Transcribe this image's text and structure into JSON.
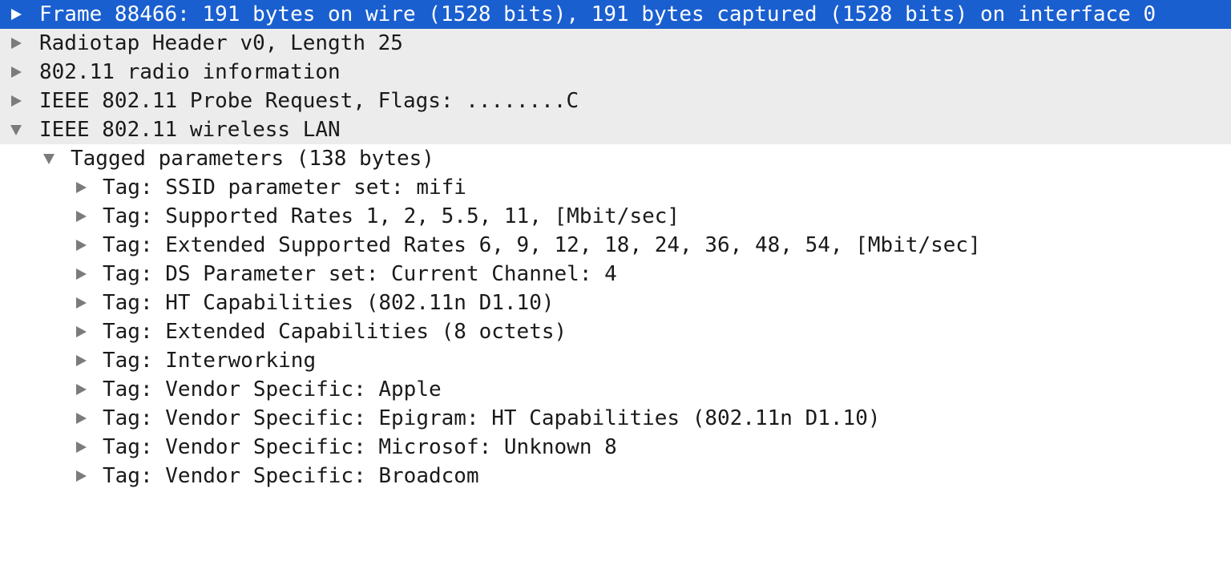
{
  "colors": {
    "selected_bg": "#1a5fd0",
    "top_level_bg": "#ececec",
    "arrow": "#7b7b7b",
    "text": "#1a1a1a"
  },
  "tree": [
    {
      "label": "Frame 88466: 191 bytes on wire (1528 bits), 191 bytes captured (1528 bits) on interface 0",
      "expanded": false,
      "selected": true,
      "icon": "disclosure-right-icon"
    },
    {
      "label": "Radiotap Header v0, Length 25",
      "expanded": false,
      "icon": "disclosure-right-icon"
    },
    {
      "label": "802.11 radio information",
      "expanded": false,
      "icon": "disclosure-right-icon"
    },
    {
      "label": "IEEE 802.11 Probe Request, Flags: ........C",
      "expanded": false,
      "icon": "disclosure-right-icon"
    },
    {
      "label": "IEEE 802.11 wireless LAN",
      "expanded": true,
      "icon": "disclosure-down-icon"
    },
    {
      "label": "Tagged parameters (138 bytes)",
      "expanded": true,
      "icon": "disclosure-down-icon"
    },
    {
      "label": "Tag: SSID parameter set: mifi",
      "expanded": false,
      "icon": "disclosure-right-icon"
    },
    {
      "label": "Tag: Supported Rates 1, 2, 5.5, 11, [Mbit/sec]",
      "expanded": false,
      "icon": "disclosure-right-icon"
    },
    {
      "label": "Tag: Extended Supported Rates 6, 9, 12, 18, 24, 36, 48, 54, [Mbit/sec]",
      "expanded": false,
      "icon": "disclosure-right-icon"
    },
    {
      "label": "Tag: DS Parameter set: Current Channel: 4",
      "expanded": false,
      "icon": "disclosure-right-icon"
    },
    {
      "label": "Tag: HT Capabilities (802.11n D1.10)",
      "expanded": false,
      "icon": "disclosure-right-icon"
    },
    {
      "label": "Tag: Extended Capabilities (8 octets)",
      "expanded": false,
      "icon": "disclosure-right-icon"
    },
    {
      "label": "Tag: Interworking",
      "expanded": false,
      "icon": "disclosure-right-icon"
    },
    {
      "label": "Tag: Vendor Specific: Apple",
      "expanded": false,
      "icon": "disclosure-right-icon"
    },
    {
      "label": "Tag: Vendor Specific: Epigram: HT Capabilities (802.11n D1.10)",
      "expanded": false,
      "icon": "disclosure-right-icon"
    },
    {
      "label": "Tag: Vendor Specific: Microsof: Unknown 8",
      "expanded": false,
      "icon": "disclosure-right-icon"
    },
    {
      "label": "Tag: Vendor Specific: Broadcom",
      "expanded": false,
      "icon": "disclosure-right-icon"
    }
  ]
}
